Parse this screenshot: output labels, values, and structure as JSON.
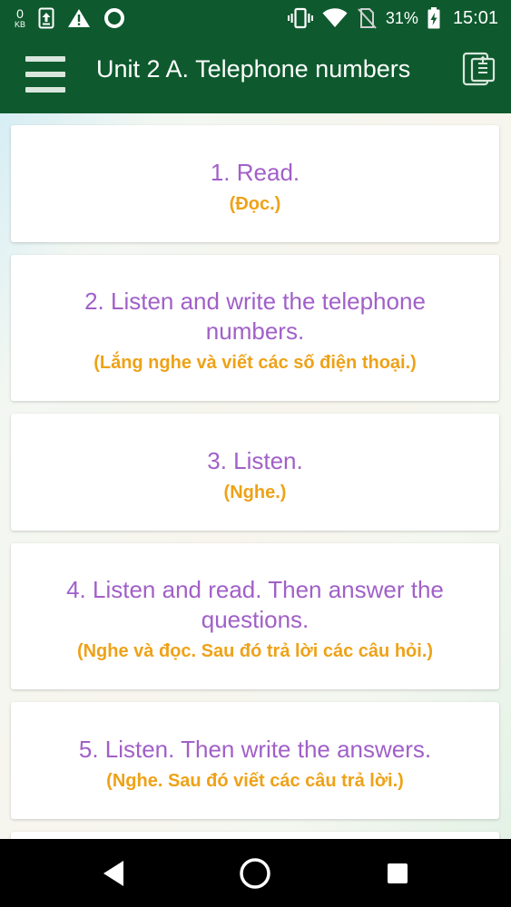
{
  "status_bar": {
    "data_usage_value": "0",
    "data_usage_unit": "KB",
    "battery_percent": "31%",
    "time": "15:01",
    "icons": [
      "upload-icon",
      "warning-icon",
      "circle-app-icon",
      "vibrate-icon",
      "wifi-icon",
      "no-sim-icon",
      "battery-charging-icon"
    ]
  },
  "app_bar": {
    "title": "Unit 2  A. Telephone numbers",
    "left_icon": "hamburger-menu-icon",
    "right_icon": "document-icon",
    "background_color": "#0e5a2e"
  },
  "lessons": [
    {
      "title": "1. Read.",
      "subtitle": "(Đọc.)"
    },
    {
      "title": "2. Listen and write the telephone numbers.",
      "subtitle": "(Lắng nghe và viết các số điện thoại.)"
    },
    {
      "title": "3. Listen.",
      "subtitle": "(Nghe.)"
    },
    {
      "title": "4. Listen and read. Then answer the questions.",
      "subtitle": "(Nghe và đọc. Sau đó trả lời các câu hỏi.)"
    },
    {
      "title": "5. Listen. Then write the answers.",
      "subtitle": "(Nghe. Sau đó viết các câu trả lời.)"
    }
  ],
  "colors": {
    "title": "#a160c8",
    "subtitle": "#eea218"
  },
  "nav_bar": {
    "icons": [
      "back-icon",
      "home-icon",
      "recent-apps-icon"
    ]
  }
}
